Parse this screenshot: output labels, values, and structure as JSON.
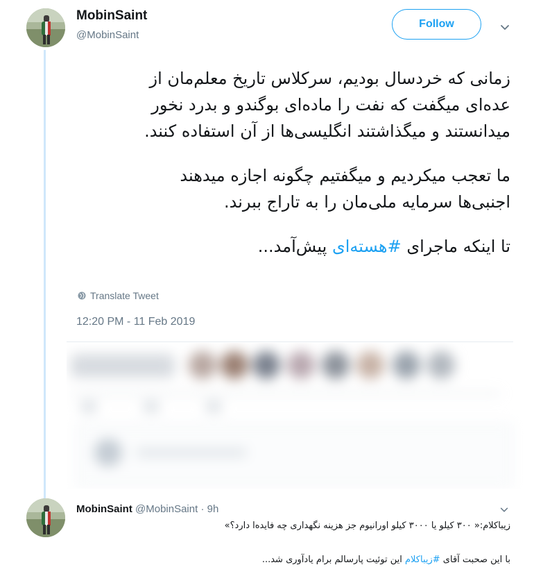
{
  "tweet": {
    "display_name": "MobinSaint",
    "handle": "@MobinSaint",
    "follow_label": "Follow",
    "paragraph1": [
      "زمانی که خردسال بودیم، سرکلاس تاریخ معلم‌مان از",
      "عده‌ای میگفت که نفت را ماده‌ای بوگندو و بدرد نخور",
      "میدانستند و میگذاشتند انگلیسی‌ها از آن استفاده کنند."
    ],
    "paragraph2": [
      "ما تعجب میکردیم و میگفتیم چگونه اجازه میدهند",
      "اجنبی‌ها سرمایه ملی‌مان را به تاراج ببرند."
    ],
    "paragraph3_before": "تا اینکه ماجرای ",
    "paragraph3_hashtag": "#هسته‌ای",
    "paragraph3_after": " پیش‌آمد...",
    "translate_label": "Translate Tweet",
    "timestamp": "12:20 PM - 11 Feb 2019"
  },
  "reply": {
    "display_name": "MobinSaint",
    "handle": "@MobinSaint",
    "separator": "·",
    "time": "9h",
    "line1": "زیباکلام:« ۳۰۰ کیلو یا ۳۰۰۰ کیلو اورانیوم جز هزینه نگهداری چه فایده‌ا دارد؟»",
    "line2_before": "با این صحبت آقای ",
    "line2_hashtag": "#زیباکلام",
    "line2_after": " این توئیت پارسالم برام یادآوری شد..."
  },
  "icons": {
    "chevron": "chevron-down-icon",
    "globe": "globe-icon",
    "avatar": "avatar"
  },
  "colors": {
    "accent": "#1da1f2",
    "muted": "#657786",
    "thread": "#cfe7fb"
  }
}
